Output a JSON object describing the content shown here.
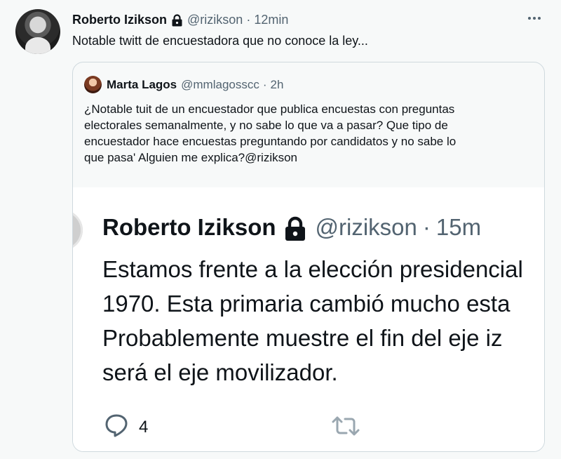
{
  "tweet": {
    "name": "Roberto Izikson",
    "handle": "@rizikson",
    "separator": "·",
    "time": "12min",
    "text": "Notable twitt de encuestadora que no conoce la ley..."
  },
  "quote": {
    "name": "Marta Lagos",
    "handle": "@mmlagosscc",
    "separator": "·",
    "time": "2h",
    "lines": [
      "¿Notable tuit de un encuestador que publica encuestas con preguntas",
      "electorales semanalmente, y no sabe lo que va a pasar? Que tipo de",
      "encuestador hace encuestas preguntando por candidatos y no sabe lo",
      "que pasa' Alguien me explica?@rizikson"
    ]
  },
  "screenshot": {
    "name": "Roberto Izikson",
    "handle": "@rizikson",
    "separator": "·",
    "time": "15m",
    "lines": [
      "Estamos frente a la elección presidencial",
      "1970. Esta primaria cambió mucho esta",
      "Probablemente muestre el fin del eje iz",
      "será el eje movilizador."
    ],
    "reply_count": "4"
  },
  "icons": {
    "more": "more-icon",
    "lock": "lock-icon",
    "reply": "reply-icon",
    "retweet": "retweet-icon"
  },
  "colors": {
    "text": "#0f1419",
    "secondary": "#536471",
    "border": "#cfd9de",
    "background": "#f7f9f9"
  }
}
